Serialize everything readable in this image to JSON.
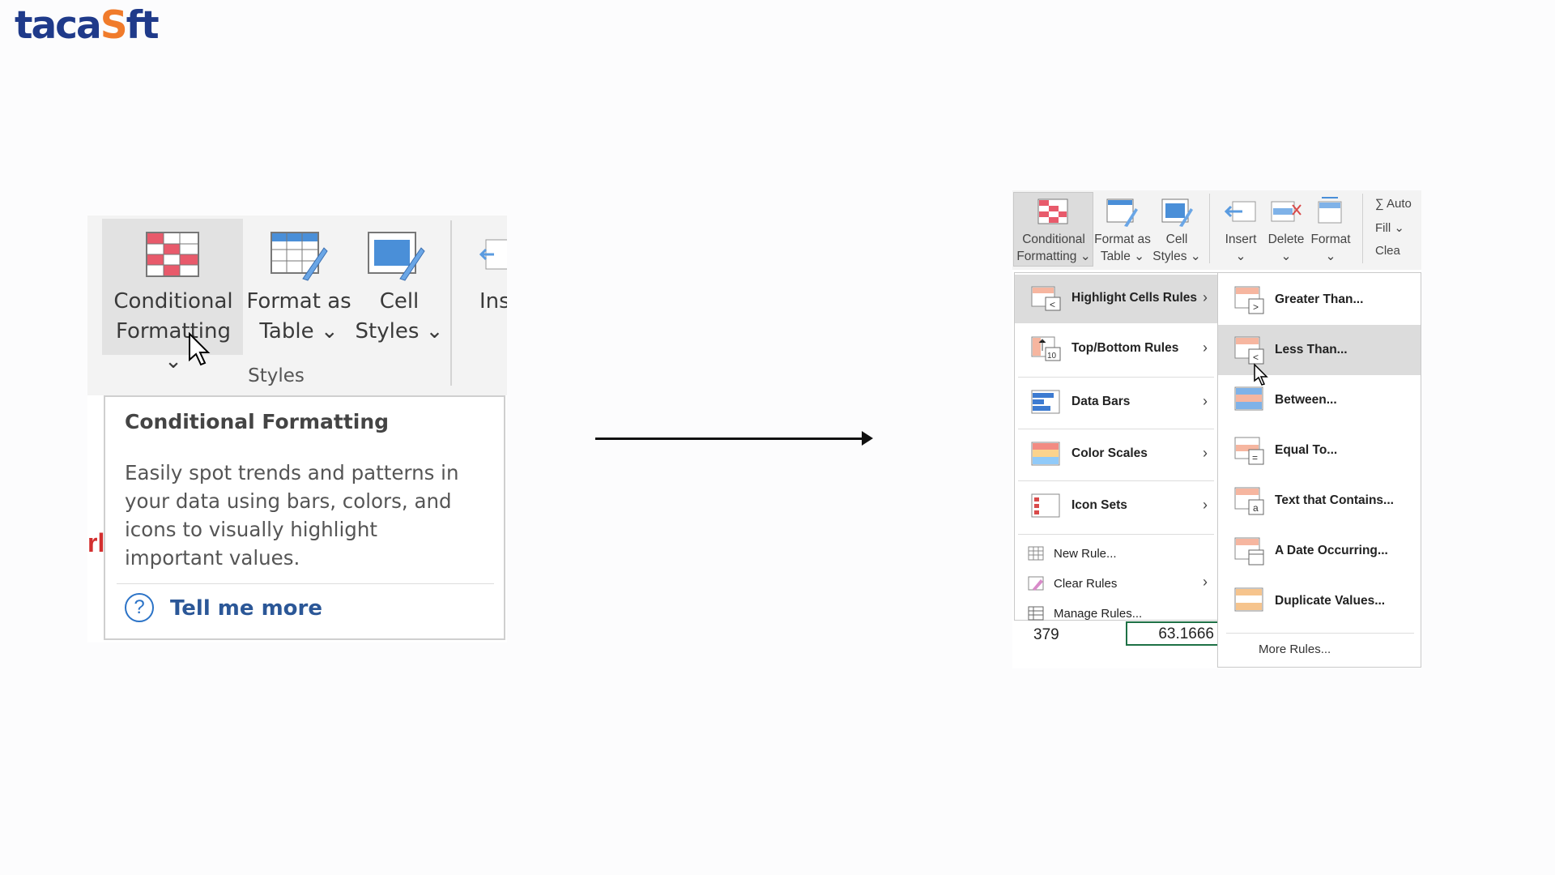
{
  "logo": {
    "text_a": "taca",
    "text_o": "S",
    "text_b": "ft"
  },
  "left": {
    "ribbon": {
      "conditional_formatting": [
        "Conditional",
        "Formatting ⌄"
      ],
      "format_as_table": [
        "Format as",
        "Table ⌄"
      ],
      "cell_styles": [
        "Cell",
        "Styles ⌄"
      ],
      "insert_partial": "Ins",
      "group_label": "Styles"
    },
    "tooltip": {
      "title": "Conditional Formatting",
      "body": "Easily spot trends and patterns in your data using bars, colors, and icons to visually highlight important values.",
      "link": "Tell me more",
      "help_icon": "?"
    },
    "red_fragment": "rl"
  },
  "right": {
    "ribbon": {
      "conditional_formatting": [
        "Conditional",
        "Formatting ⌄"
      ],
      "format_as_table": [
        "Format as",
        "Table ⌄"
      ],
      "cell_styles": [
        "Cell",
        "Styles ⌄"
      ],
      "insert": "Insert",
      "delete": "Delete",
      "format": "Format",
      "autosum": "∑ Auto",
      "fill": "Fill ⌄",
      "clear": "Clea"
    },
    "menu": {
      "items": [
        "Highlight Cells Rules",
        "Top/Bottom Rules",
        "Data Bars",
        "Color Scales",
        "Icon Sets"
      ],
      "small_items": [
        "New Rule...",
        "Clear Rules",
        "Manage Rules..."
      ]
    },
    "submenu": {
      "items": [
        "Greater Than...",
        "Less Than...",
        "Between...",
        "Equal To...",
        "Text that Contains...",
        "A Date Occurring...",
        "Duplicate Values..."
      ],
      "more": "More Rules..."
    },
    "cells": {
      "a": "379",
      "b": "63.1666"
    }
  }
}
